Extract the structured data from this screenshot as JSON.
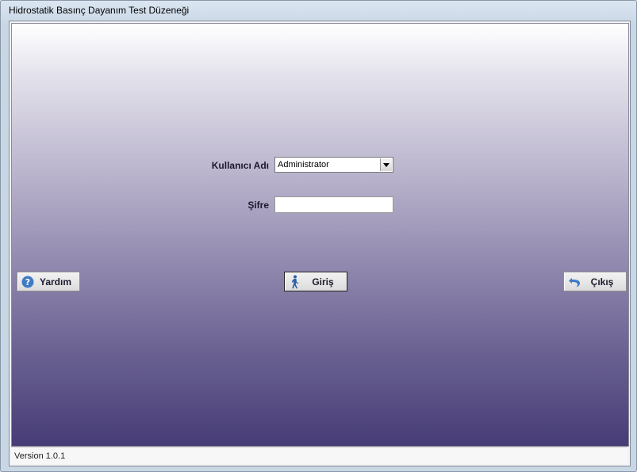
{
  "window": {
    "title": "Hidrostatik Basınç Dayanım Test Düzeneği"
  },
  "form": {
    "username_label": "Kullanıcı Adı",
    "username_value": "Administrator",
    "password_label": "Şifre",
    "password_value": ""
  },
  "buttons": {
    "help": "Yardım",
    "login": "Giriş",
    "exit": "Çıkış"
  },
  "icons": {
    "help": "question-circle-icon",
    "login": "walking-person-icon",
    "exit": "undo-arrow-icon"
  },
  "status": {
    "version": "Version 1.0.1"
  },
  "colors": {
    "gradient_top": "#ffffff",
    "gradient_bottom": "#473c76",
    "icon_blue": "#3d7bc4"
  }
}
